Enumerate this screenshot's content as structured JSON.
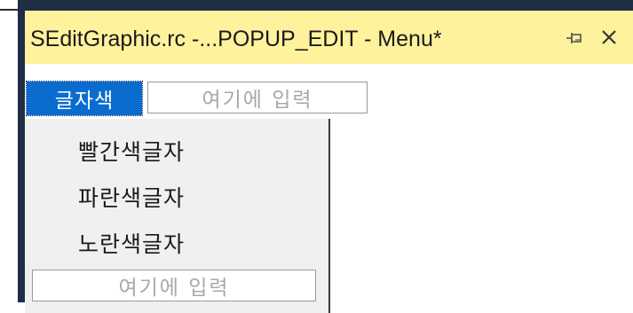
{
  "tab": {
    "title": "SEditGraphic.rc -...POPUP_EDIT - Menu*",
    "pin_icon": "pin-icon",
    "close_icon": "close-icon"
  },
  "menu_bar": {
    "items": [
      {
        "label": "글자색",
        "selected": true
      }
    ],
    "type_here": "여기에 입력"
  },
  "dropdown": {
    "items": [
      {
        "label": "빨간색글자"
      },
      {
        "label": "파란색글자"
      },
      {
        "label": "노란색글자"
      }
    ],
    "type_here": "여기에 입력"
  },
  "colors": {
    "tab_background": "#fff29d",
    "selected_background": "#0b6cd0",
    "frame": "#1f2d45",
    "dropdown_background": "#f0f0f0"
  }
}
